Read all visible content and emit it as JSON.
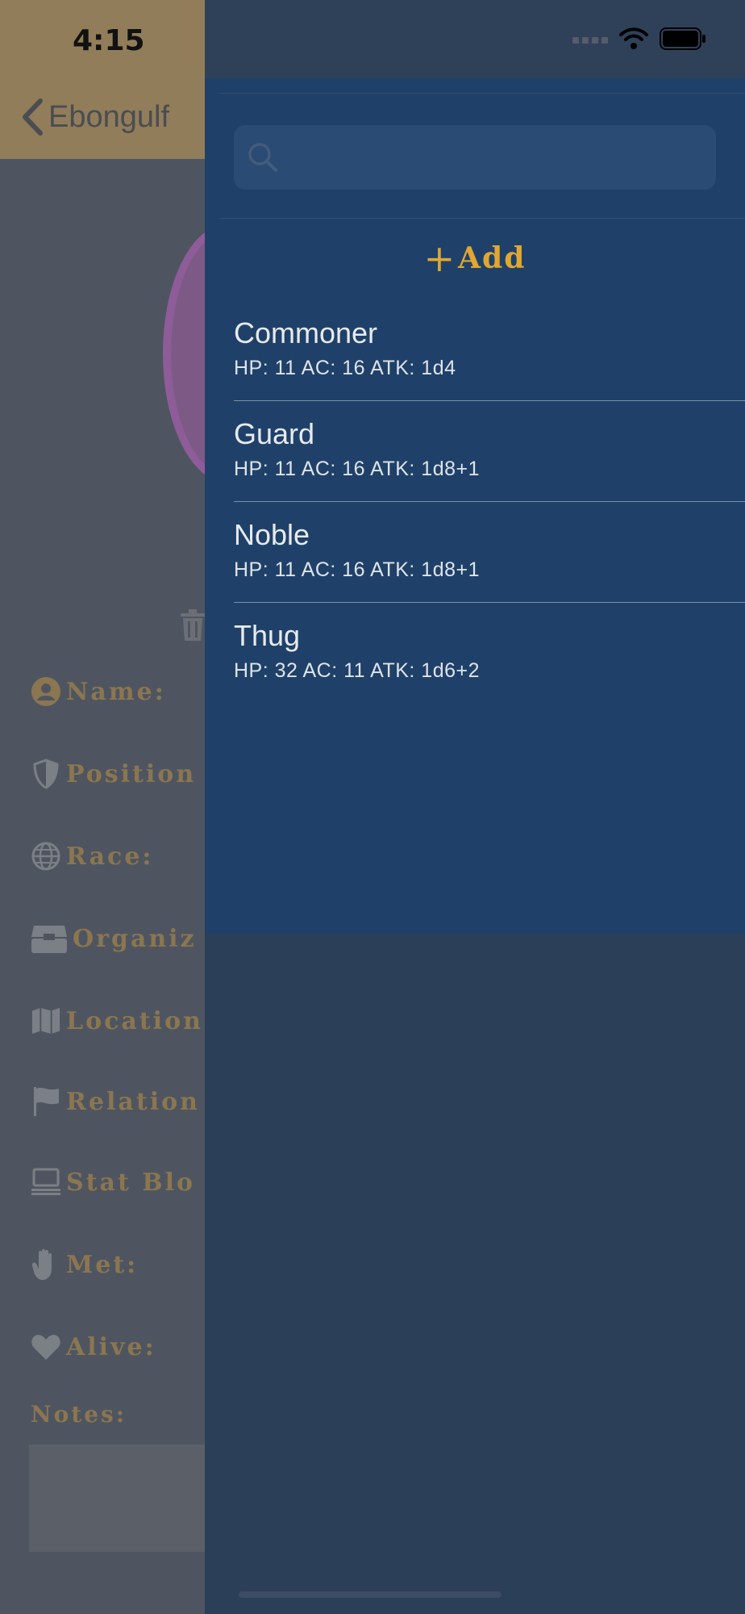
{
  "status_bar": {
    "time": "4:15"
  },
  "nav": {
    "back_label": "Ebongulf"
  },
  "form_fields": [
    {
      "label": "Name:",
      "icon": "user-circle-icon"
    },
    {
      "label": "Position",
      "icon": "shield-icon"
    },
    {
      "label": "Race:",
      "icon": "globe-icon"
    },
    {
      "label": "Organiz",
      "icon": "archive-box-icon"
    },
    {
      "label": "Location",
      "icon": "map-icon"
    },
    {
      "label": "Relation",
      "icon": "flag-icon"
    },
    {
      "label": "Stat Blo",
      "icon": "laptop-icon"
    },
    {
      "label": "Met:",
      "icon": "hand-icon"
    },
    {
      "label": "Alive:",
      "icon": "heart-icon"
    }
  ],
  "notes": {
    "label": "Notes:"
  },
  "drawer": {
    "search": {
      "placeholder": ""
    },
    "add_label": "Add",
    "items": [
      {
        "name": "Commoner",
        "stats": "HP: 11 AC: 16 ATK: 1d4"
      },
      {
        "name": "Guard",
        "stats": "HP: 11 AC: 16 ATK: 1d8+1"
      },
      {
        "name": "Noble",
        "stats": "HP: 11 AC: 16 ATK: 1d8+1"
      },
      {
        "name": "Thug",
        "stats": "HP: 32 AC: 11 ATK: 1d6+2"
      }
    ]
  },
  "colors": {
    "accent_gold": "#e2a731",
    "drawer_bg": "#1f4169",
    "label_gold": "#8a7650"
  }
}
